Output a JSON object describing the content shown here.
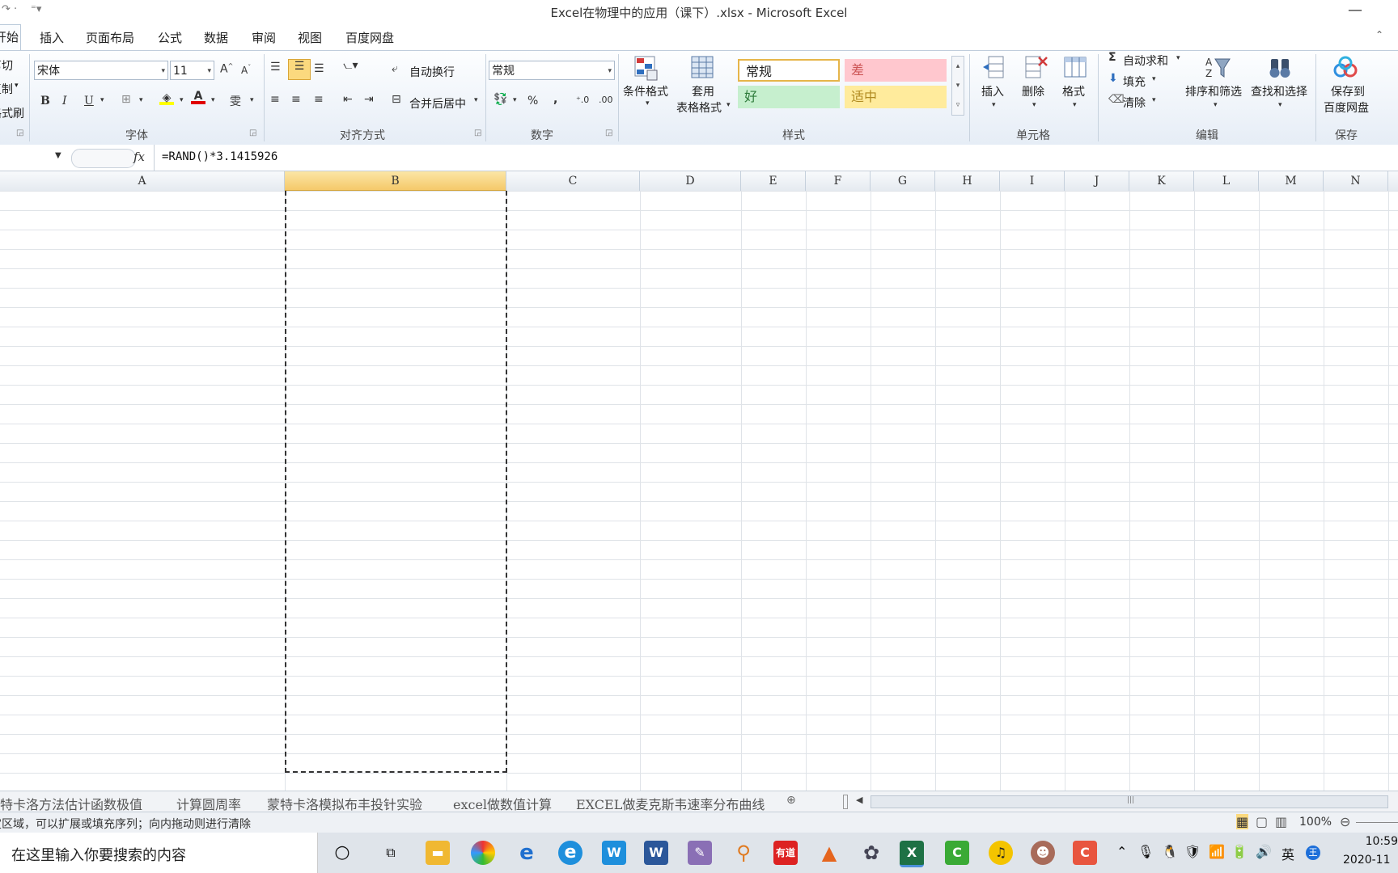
{
  "window": {
    "title": "Excel在物理中的应用（课下）.xlsx - Microsoft Excel"
  },
  "menu_tabs": [
    "开始",
    "插入",
    "页面布局",
    "公式",
    "数据",
    "审阅",
    "视图",
    "百度网盘"
  ],
  "ribbon": {
    "clipboard": {
      "cut": "剪切",
      "copy": "复制",
      "format_painter": "格式刷"
    },
    "font": {
      "name": "宋体",
      "size": "11",
      "group_label": "字体",
      "bold": "B",
      "italic": "I",
      "underline": "U"
    },
    "alignment": {
      "wrap_text": "自动换行",
      "merge_center": "合并后居中",
      "group_label": "对齐方式"
    },
    "number": {
      "format": "常规",
      "percent": "%",
      "comma": ",",
      "group_label": "数字"
    },
    "styles": {
      "conditional_format": "条件格式",
      "table_format_line1": "套用",
      "table_format_line2": "表格格式",
      "cell_normal": "常规",
      "cell_bad": "差",
      "cell_good": "好",
      "cell_neutral": "适中",
      "group_label": "样式"
    },
    "cells": {
      "insert": "插入",
      "delete": "删除",
      "format": "格式",
      "group_label": "单元格"
    },
    "editing": {
      "autosum": "自动求和",
      "fill": "填充",
      "clear": "清除",
      "sort_filter": "排序和筛选",
      "find_select": "查找和选择",
      "group_label": "编辑"
    },
    "save": {
      "line1": "保存到",
      "line2": "百度网盘",
      "group_label": "保存"
    }
  },
  "formula_bar": {
    "fx": "fx",
    "formula": "=RAND()*3.1415926"
  },
  "columns": [
    "A",
    "B",
    "C",
    "D",
    "E",
    "F",
    "G",
    "H",
    "I",
    "J",
    "K",
    "L",
    "M",
    "N"
  ],
  "selected_column": "B",
  "sheet_tabs": [
    "蒙特卡洛方法估计函数极值",
    "计算圆周率",
    "蒙特卡洛模拟布丰投针实验",
    "excel做数值计算",
    "EXCEL做麦克斯韦速率分布曲线"
  ],
  "status": {
    "message": "定区域，可以扩展或填充序列；向内拖动则进行清除",
    "zoom": "100%"
  },
  "taskbar": {
    "search_placeholder": "在这里输入你要搜索的内容",
    "time": "10:59",
    "date": "2020-11",
    "ime": "英"
  },
  "colors": {
    "accent": "#f5c96a",
    "ribbon_bg": "#e6edf6",
    "excel_green": "#1e7145"
  }
}
